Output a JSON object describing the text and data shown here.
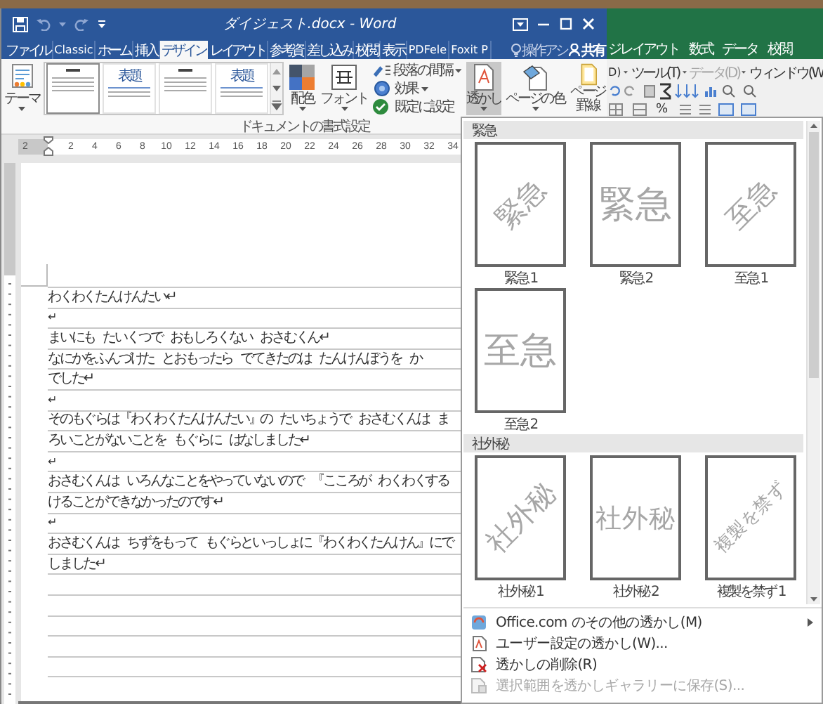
{
  "word_window": {
    "title": "ダイジェスト.docx - Word",
    "tabs": [
      {
        "label": "ファイル",
        "selected": false
      },
      {
        "label": "Classic",
        "selected": false
      },
      {
        "label": "ホーム",
        "selected": false
      },
      {
        "label": "挿入",
        "selected": false
      },
      {
        "label": "デザイン",
        "selected": true
      },
      {
        "label": "レイアウト",
        "selected": false
      },
      {
        "label": "参考資",
        "selected": false
      },
      {
        "label": "差し込み",
        "selected": false
      },
      {
        "label": "校閲",
        "selected": false
      },
      {
        "label": "表示",
        "selected": false
      },
      {
        "label": "PDFele",
        "selected": false
      },
      {
        "label": "Foxit P",
        "selected": false
      }
    ],
    "tell_me": "操作アシ",
    "share_button": "共有",
    "ribbon": {
      "left_buttons": [
        {
          "label": "テーマ",
          "kind": "theme",
          "dropdown": true
        }
      ],
      "style_gallery": [
        {
          "kind": "centered",
          "selected": true
        },
        {
          "kind": "left",
          "title": "表題",
          "selected": false
        },
        {
          "kind": "centered",
          "selected": false
        },
        {
          "kind": "left",
          "title": "表題",
          "selected": false
        }
      ],
      "mid_buttons": [
        {
          "label": "配色",
          "kind": "colors",
          "dropdown": true
        },
        {
          "label": "フォント",
          "kind": "fonts",
          "dropdown": true
        }
      ],
      "options": [
        {
          "label": "段落の間隔",
          "kind": "spacing",
          "dropdown": true
        },
        {
          "label": "効果",
          "kind": "effects",
          "dropdown": true
        },
        {
          "label": "既定に設定",
          "kind": "default",
          "dropdown": false
        }
      ],
      "page_buttons": [
        {
          "label": "透かし",
          "kind": "watermark",
          "dropdown": true,
          "selected": true
        },
        {
          "label": "ページの色",
          "kind": "page_color",
          "dropdown": true,
          "selected": false
        },
        {
          "label": "ページ罫線",
          "kind": "page_borders",
          "dropdown": false,
          "selected": false
        }
      ],
      "group_label": "ドキュメントの書式設定"
    },
    "ruler": [
      "2",
      "2",
      "4",
      "6",
      "8",
      "10",
      "12",
      "14",
      "16",
      "18",
      "20",
      "22",
      "24",
      "26",
      "28",
      "30",
      "32",
      "34"
    ],
    "document": {
      "lines": [
        "わくわくたんけんたい↵",
        "↵",
        "まいにも たいくつで おもしろくない おさむくん↵",
        "なにかをふんづけた とおもったら でてきたのは たんけんぼうを か",
        "でした↵",
        "↵",
        "そのもぐらは『わくわくたんけんたい』の たいちょうで おさむくんは ま",
        "ろいことがないことを もぐらに はなしました↵",
        "↵",
        "おさむくんは いろんなことをやっていないので 『こころが わくわくする",
        "けることができなかったのです↵",
        "↵",
        "おさむくんは ちずをもって もぐらといっしょに『わくわくたんけん』にで",
        "しました↵"
      ]
    }
  },
  "excel_window": {
    "tabs": [
      {
        "label": "ジレイアウト",
        "selected": false
      },
      {
        "label": "数式",
        "selected": false
      },
      {
        "label": "データ",
        "selected": false
      },
      {
        "label": "校閲",
        "selected": false
      }
    ],
    "menu": [
      {
        "label": "D)",
        "dropdown": true,
        "disabled": false
      },
      {
        "label": "ツール(T)",
        "dropdown": true,
        "disabled": false
      },
      {
        "label": "データ(D)",
        "dropdown": true,
        "disabled": true
      },
      {
        "label": "ウィンドウ(W",
        "dropdown": false,
        "disabled": false
      }
    ],
    "percent_button": "%"
  },
  "watermark_menu": {
    "sections": [
      {
        "title": "緊急",
        "items": [
          {
            "label": "緊急 1",
            "watermark": "緊急",
            "kind": "diagonal"
          },
          {
            "label": "緊急 2",
            "watermark": "緊急",
            "kind": "horizontal"
          },
          {
            "label": "至急 1",
            "watermark": "至急",
            "kind": "diagonal"
          },
          {
            "label": "至急 2",
            "watermark": "至急",
            "kind": "horizontal"
          }
        ]
      },
      {
        "title": "社外秘",
        "items": [
          {
            "label": "社外秘 1",
            "watermark": "社外秘",
            "kind": "diagonal"
          },
          {
            "label": "社外秘 2",
            "watermark": "社外秘",
            "kind": "horizontal"
          },
          {
            "label": "複製を禁ず 1",
            "watermark": "複製を禁ず",
            "kind": "diagonal"
          }
        ]
      }
    ],
    "commands": [
      {
        "label": "Office.com のその他の透かし(M)",
        "kind": "online",
        "submenu": true,
        "disabled": false
      },
      {
        "label": "ユーザー設定の透かし(W)...",
        "kind": "custom",
        "submenu": false,
        "disabled": false
      },
      {
        "label": "透かしの削除(R)",
        "kind": "remove",
        "submenu": false,
        "disabled": false
      },
      {
        "label": "選択範囲を透かしギャラリーに保存(S)...",
        "kind": "save",
        "submenu": false,
        "disabled": true
      }
    ]
  }
}
